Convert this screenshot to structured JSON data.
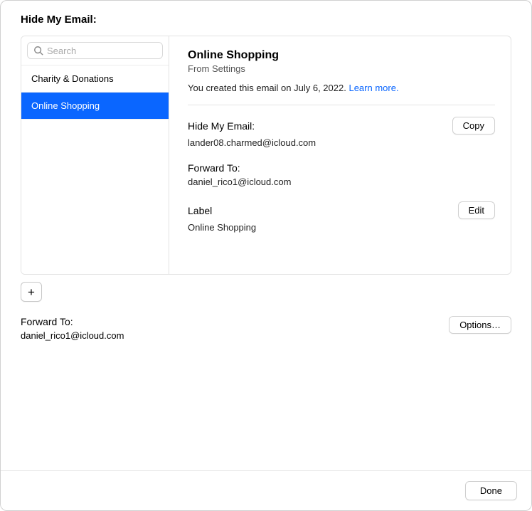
{
  "pageTitle": "Hide My Email:",
  "search": {
    "placeholder": "Search",
    "value": ""
  },
  "sidebar": {
    "items": [
      {
        "label": "Charity & Donations",
        "selected": false
      },
      {
        "label": "Online Shopping",
        "selected": true
      }
    ]
  },
  "detail": {
    "title": "Online Shopping",
    "subtitle": "From Settings",
    "createdPrefix": "You created this email on ",
    "createdDate": "July 6, 2022",
    "createdSuffix": ". ",
    "learnMore": "Learn more.",
    "hideMyEmail": {
      "label": "Hide My Email:",
      "value": "lander08.charmed@icloud.com",
      "copyLabel": "Copy"
    },
    "forwardTo": {
      "label": "Forward To:",
      "value": "daniel_rico1@icloud.com"
    },
    "labelField": {
      "label": "Label",
      "value": "Online Shopping",
      "editLabel": "Edit"
    }
  },
  "addButton": "+",
  "globalForward": {
    "label": "Forward To:",
    "value": "daniel_rico1@icloud.com",
    "optionsLabel": "Options…"
  },
  "footer": {
    "doneLabel": "Done"
  }
}
